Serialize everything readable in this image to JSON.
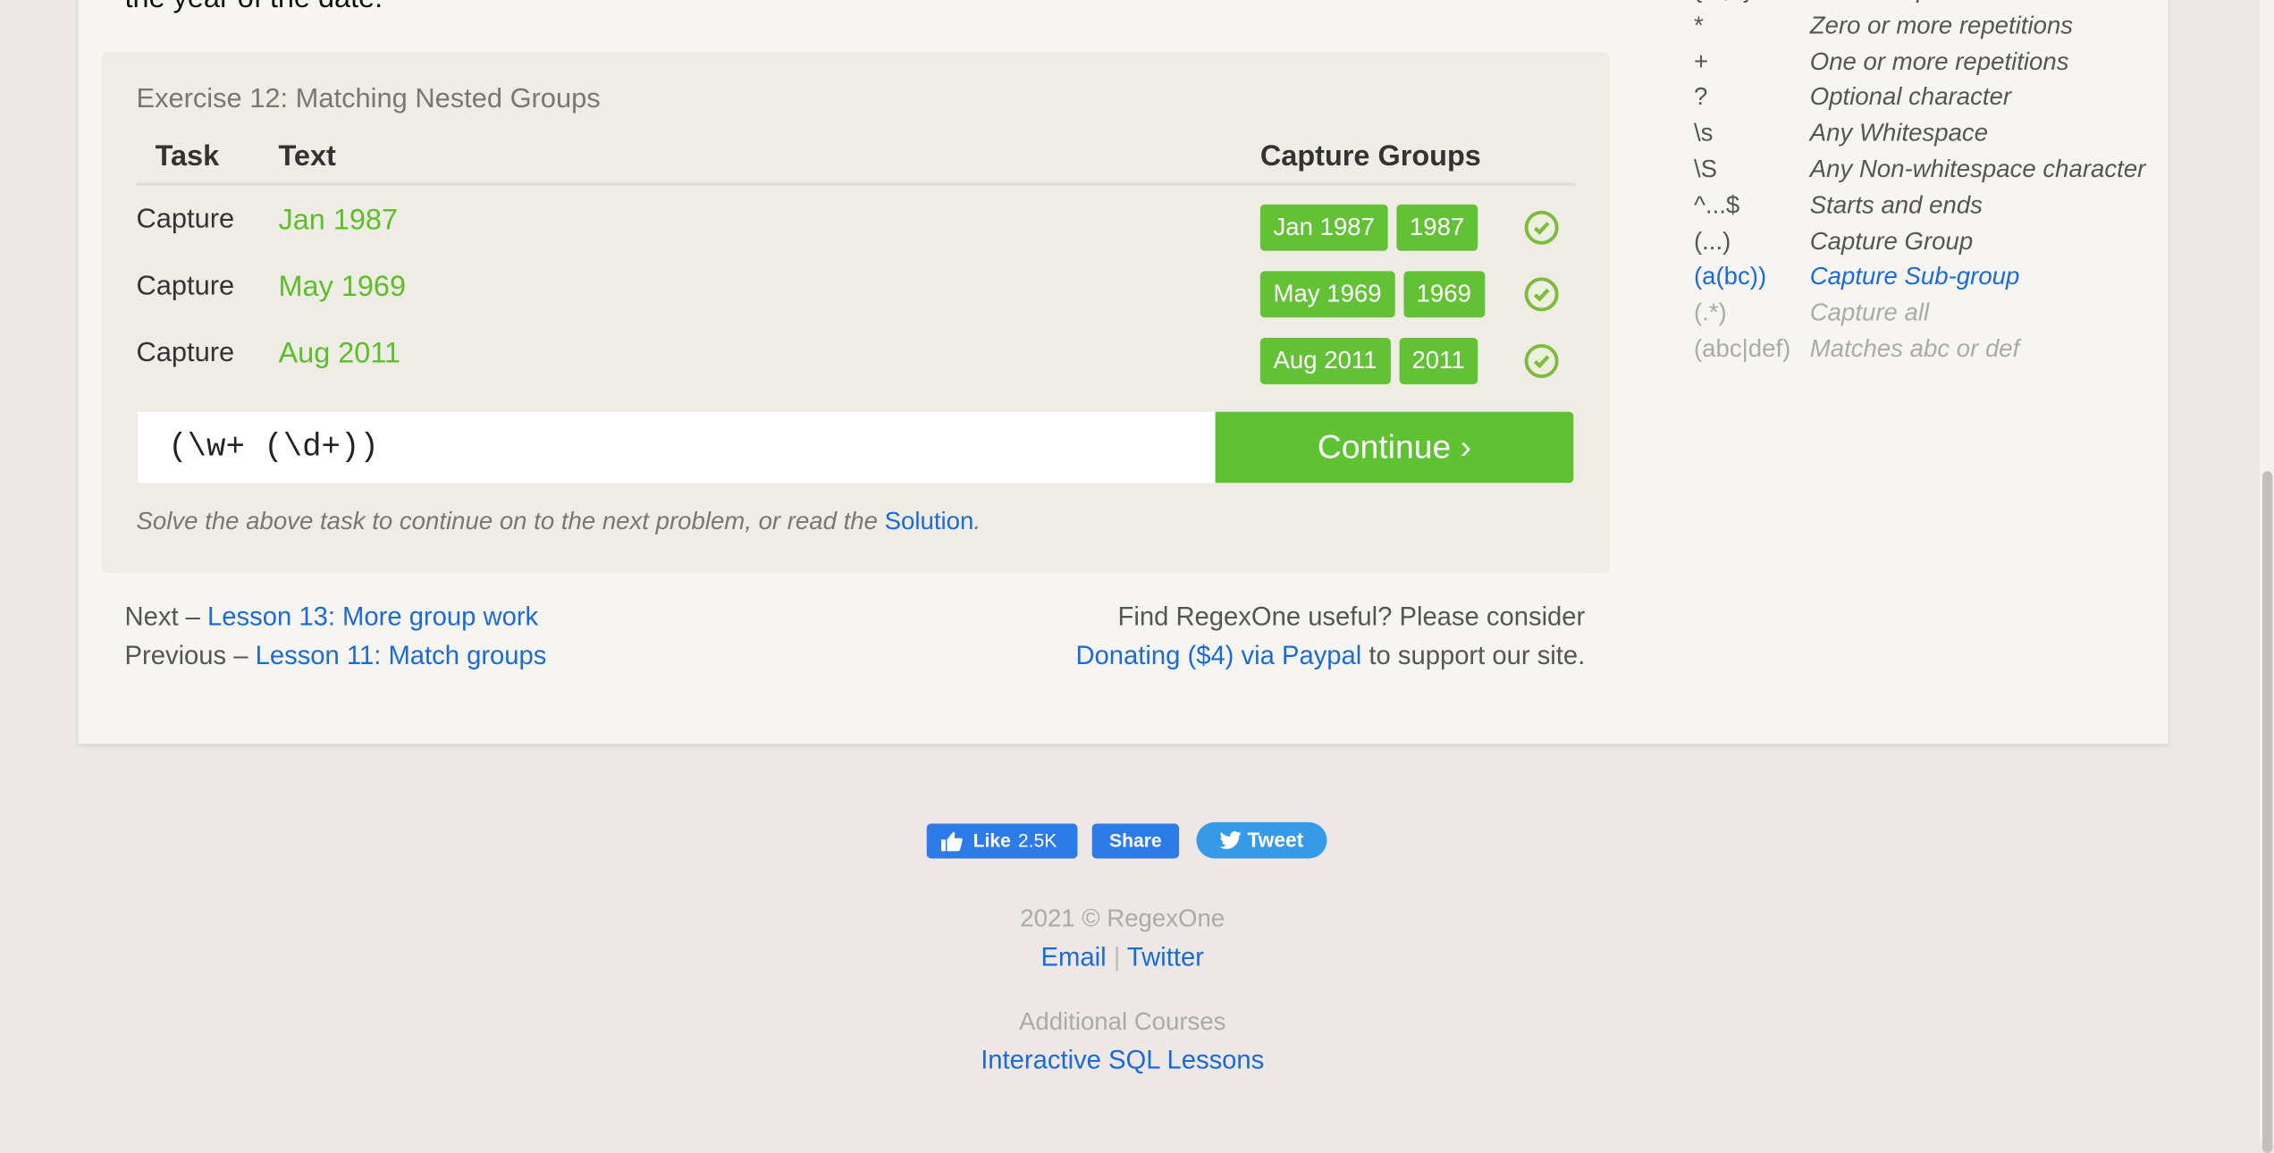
{
  "intro_text_tail": "the year of the date.",
  "exercise": {
    "title": "Exercise 12: Matching Nested Groups",
    "headers": {
      "task": "Task",
      "text": "Text",
      "capture_groups": "Capture Groups"
    },
    "rows": [
      {
        "task": "Capture",
        "text": "Jan 1987",
        "groups": [
          "Jan 1987",
          "1987"
        ],
        "status": "success"
      },
      {
        "task": "Capture",
        "text": "May 1969",
        "groups": [
          "May 1969",
          "1969"
        ],
        "status": "success"
      },
      {
        "task": "Capture",
        "text": "Aug 2011",
        "groups": [
          "Aug 2011",
          "2011"
        ],
        "status": "success"
      }
    ],
    "input_value": "(\\w+ (\\d+))",
    "continue_label": "Continue ›",
    "hint_prefix": "Solve the above task to continue on to the next problem, or read the ",
    "hint_link": "Solution",
    "hint_suffix": "."
  },
  "navigation": {
    "next_prefix": "Next – ",
    "next_link": "Lesson 13: More group work",
    "prev_prefix": "Previous – ",
    "prev_link": "Lesson 11: Match groups"
  },
  "donate": {
    "line1": "Find RegexOne useful? Please consider",
    "link": "Donating ($4) via Paypal",
    "suffix": " to support our site."
  },
  "cheatsheet": [
    {
      "symbol": "{m,n}",
      "desc": "m to n Repetitions",
      "state": "normal"
    },
    {
      "symbol": "*",
      "desc": "Zero or more repetitions",
      "state": "normal"
    },
    {
      "symbol": "+",
      "desc": "One or more repetitions",
      "state": "normal"
    },
    {
      "symbol": "?",
      "desc": "Optional character",
      "state": "normal"
    },
    {
      "symbol": "\\s",
      "desc": "Any Whitespace",
      "state": "normal"
    },
    {
      "symbol": "\\S",
      "desc": "Any Non-whitespace character",
      "state": "normal"
    },
    {
      "symbol": "^...$",
      "desc": "Starts and ends",
      "state": "normal"
    },
    {
      "symbol": "(...)",
      "desc": "Capture Group",
      "state": "normal"
    },
    {
      "symbol": "(a(bc))",
      "desc": "Capture Sub-group",
      "state": "current"
    },
    {
      "symbol": "(.*)",
      "desc": "Capture all",
      "state": "future"
    },
    {
      "symbol": "(abc|def)",
      "desc": "Matches abc or def",
      "state": "future"
    }
  ],
  "social": {
    "like_label": "Like",
    "like_count": "2.5K",
    "share_label": "Share",
    "tweet_label": "Tweet"
  },
  "footer": {
    "copyright": "2021 © RegexOne",
    "email": "Email",
    "separator": "|",
    "twitter": "Twitter",
    "additional": "Additional Courses",
    "sql_link": "Interactive SQL Lessons"
  },
  "colors": {
    "green": "#62c134",
    "link": "#1a6ad9",
    "facebook": "#2d7be8",
    "twitter": "#359be8"
  }
}
